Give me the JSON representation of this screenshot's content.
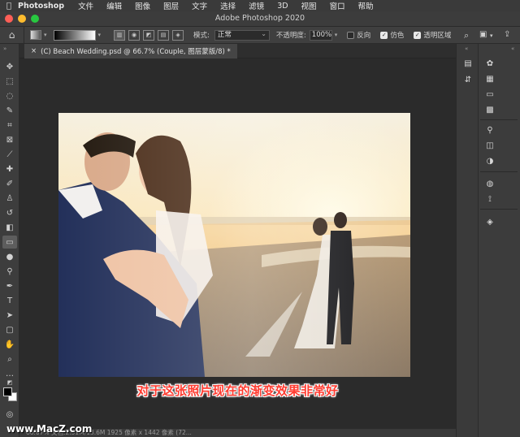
{
  "menubar": {
    "apple": "",
    "items": [
      "Photoshop",
      "文件",
      "编辑",
      "图像",
      "图层",
      "文字",
      "选择",
      "滤镜",
      "3D",
      "视图",
      "窗口",
      "帮助"
    ]
  },
  "window": {
    "title": "Adobe Photoshop 2020"
  },
  "options": {
    "mode_label": "模式:",
    "mode_value": "正常",
    "opacity_label": "不透明度:",
    "opacity_value": "100%",
    "reverse_label": "反向",
    "reverse_checked": false,
    "dither_label": "仿色",
    "dither_checked": true,
    "transparency_label": "透明区域",
    "transparency_checked": true
  },
  "document": {
    "tab_title": "(C) Beach Wedding.psd @ 66.7% (Couple, 图层蒙版/8) *",
    "close_glyph": "×"
  },
  "status": {
    "text": "66.67%     文档:2.51M/13.6M   1925 像素 x 1442 像素 (72..."
  },
  "caption": {
    "subtitle": "对于这张照片现在的渐变效果非常好"
  },
  "watermark": {
    "text": "www.MacZ.com"
  },
  "colors": {
    "accent_red": "#ff3b30",
    "ui_dark": "#2b2b2b",
    "panel": "#3c3c3c"
  }
}
